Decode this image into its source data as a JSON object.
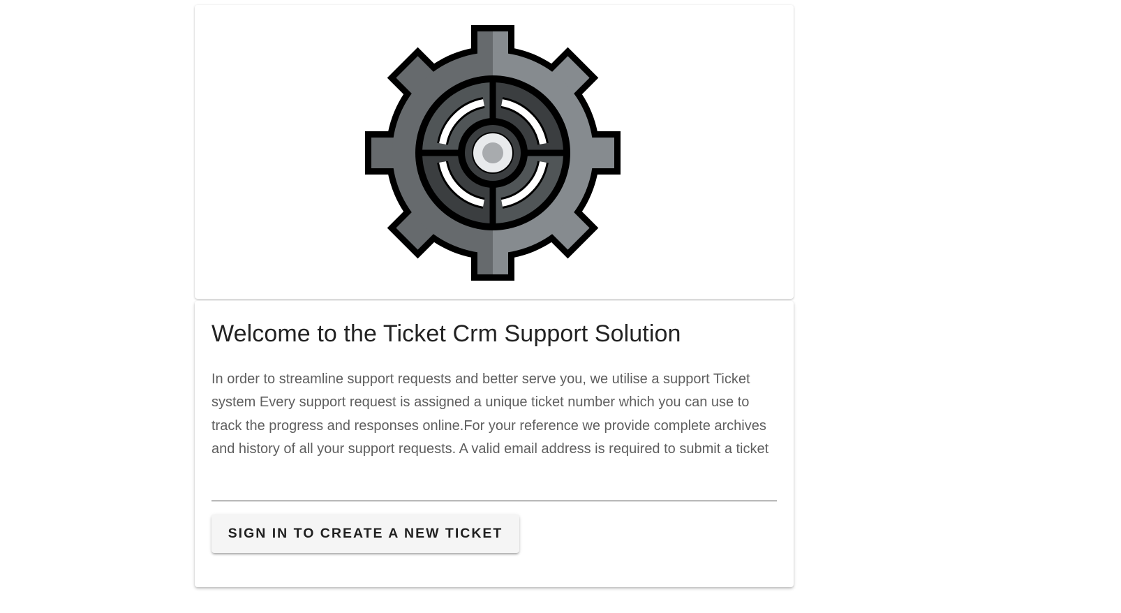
{
  "hero": {
    "image_icon": "gear-icon",
    "colors": {
      "outline": "#000000",
      "gear_left": "#666a6d",
      "gear_right": "#868b8f",
      "inner_dark": "#3b3e40",
      "inner_light": "#505557",
      "arc": "#ffffff",
      "hub_ring": "#e8eaec",
      "hub_center": "#a8abae"
    }
  },
  "welcome": {
    "title": "Welcome to the Ticket Crm Support Solution",
    "description": "In order to streamline support requests and better serve you, we utilise a support Ticket system Every support request is assigned a unique ticket number which you can use to track the progress and responses online.For your reference we provide complete archives and history of all your support requests. A valid email address is required to submit a ticket",
    "button_label": "SIGN IN TO CREATE A NEW TICKET"
  }
}
